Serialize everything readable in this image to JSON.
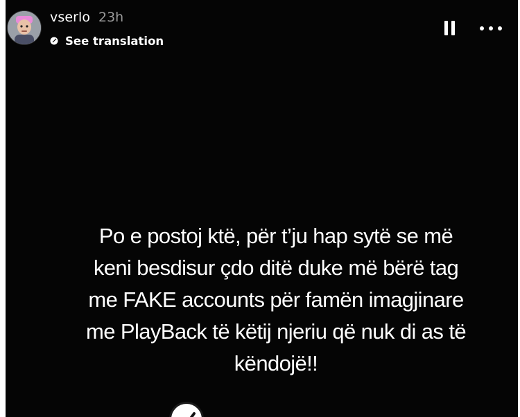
{
  "header": {
    "username": "vserlo",
    "time_ago": "23h",
    "see_translation_label": "See translation",
    "avatar_icon": "avatar-icon",
    "translation_icon": "translate-icon",
    "pause_icon": "pause-icon",
    "more_icon": "more-options-icon"
  },
  "story": {
    "text": "Po e postoj ktë, për t’ju hap sytë se më\nkeni besdisur çdo ditë duke më bërë tag\nme FAKE accounts për famën imagjinare\nme PlayBack të këtij njeriu që nuk di as të\nkëndojë!!",
    "background_color": "#050505",
    "text_color": "#ffffff",
    "sticker_icon": "check-sticker-icon"
  }
}
